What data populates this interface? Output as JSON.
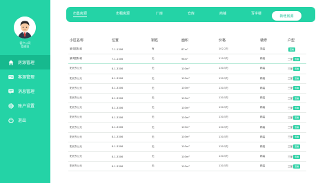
{
  "theme": {
    "accent": "#24d3a6",
    "accent_dark": "#16b98e"
  },
  "user": {
    "name": "客户公司",
    "role": "管理员"
  },
  "nav": {
    "items": [
      {
        "label": "房源管理",
        "icon": "home-icon",
        "active": true
      },
      {
        "label": "客源管理",
        "icon": "id-card-icon",
        "active": false
      },
      {
        "label": "消息管理",
        "icon": "message-icon",
        "active": false
      },
      {
        "label": "账户设置",
        "icon": "gear-icon",
        "active": false
      },
      {
        "label": "退出",
        "icon": "logout-icon",
        "active": false
      }
    ]
  },
  "tabs": [
    {
      "label": "出售房源",
      "active": true
    },
    {
      "label": "出租房源",
      "active": false
    },
    {
      "label": "厂房",
      "active": false
    },
    {
      "label": "仓库",
      "active": false
    },
    {
      "label": "商铺",
      "active": false
    },
    {
      "label": "写字楼",
      "active": false
    }
  ],
  "add_button": "新增房源",
  "table": {
    "headers": [
      "小区名称",
      "位置",
      "钥匙",
      "面积",
      "价格",
      "装修",
      "户型"
    ],
    "rows": [
      {
        "name": "景湾国际城",
        "location": "7-1-1306",
        "key": "有",
        "area": "87m²",
        "price": "102.2万",
        "decoration": "简装",
        "layout": "",
        "badge": "查看"
      },
      {
        "name": "景湾国际城",
        "location": "7-1-1306",
        "key": "无",
        "area": "98m²",
        "price": "119.5万",
        "decoration": "精装",
        "layout": "三室",
        "badge": "查看"
      },
      {
        "name": "阳光东公元",
        "location": "8-1-3306",
        "key": "无",
        "area": "103m²",
        "price": "130.5万",
        "decoration": "精装",
        "layout": "三室",
        "badge": "查看"
      },
      {
        "name": "阳光东公元",
        "location": "8-1-3306",
        "key": "无",
        "area": "103m²",
        "price": "130.5万",
        "decoration": "精装",
        "layout": "三室",
        "badge": "查看"
      },
      {
        "name": "阳光东公元",
        "location": "8-1-3306",
        "key": "无",
        "area": "103m²",
        "price": "130.5万",
        "decoration": "精装",
        "layout": "三室",
        "badge": "查看"
      },
      {
        "name": "阳光东公元",
        "location": "8-1-3306",
        "key": "无",
        "area": "103m²",
        "price": "130.5万",
        "decoration": "精装",
        "layout": "三室",
        "badge": "查看"
      },
      {
        "name": "阳光东公元",
        "location": "8-1-3306",
        "key": "无",
        "area": "103m²",
        "price": "130.5万",
        "decoration": "精装",
        "layout": "三室",
        "badge": "查看"
      },
      {
        "name": "阳光东公元",
        "location": "8-1-3306",
        "key": "无",
        "area": "103m²",
        "price": "130.5万",
        "decoration": "精装",
        "layout": "三室",
        "badge": "查看"
      },
      {
        "name": "阳光东公元",
        "location": "8-1-3306",
        "key": "无",
        "area": "103m²",
        "price": "130.5万",
        "decoration": "精装",
        "layout": "三室",
        "badge": "查看"
      },
      {
        "name": "阳光东公元",
        "location": "8-1-3306",
        "key": "无",
        "area": "103m²",
        "price": "130.5万",
        "decoration": "精装",
        "layout": "三室",
        "badge": "查看"
      },
      {
        "name": "阳光东公元",
        "location": "8-1-3306",
        "key": "无",
        "area": "103m²",
        "price": "130.5万",
        "decoration": "精装",
        "layout": "三室",
        "badge": "查看"
      },
      {
        "name": "阳光东公元",
        "location": "8-1-3306",
        "key": "无",
        "area": "103m²",
        "price": "130.5万",
        "decoration": "精装",
        "layout": "三室",
        "badge": "查看"
      },
      {
        "name": "阳光东公元",
        "location": "8-1-3306",
        "key": "无",
        "area": "103m²",
        "price": "130.5万",
        "decoration": "精装",
        "layout": "三室",
        "badge": "查看"
      }
    ]
  }
}
